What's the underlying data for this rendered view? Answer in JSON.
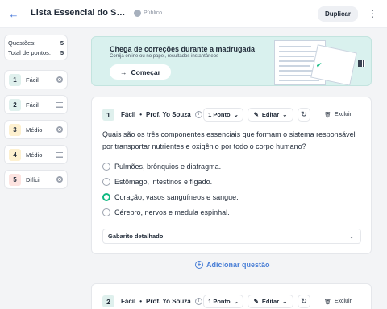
{
  "header": {
    "title": "Lista Essencial do Sistema …",
    "visibility": "Público",
    "duplicate_label": "Duplicar"
  },
  "stats": {
    "questions_label": "Questões:",
    "questions_value": "5",
    "points_label": "Total de pontos:",
    "points_value": "5"
  },
  "sidebar": {
    "items": [
      {
        "number": "1",
        "label": "Fácil",
        "icon": "radio-icon",
        "color": "#dff0ed"
      },
      {
        "number": "2",
        "label": "Fácil",
        "icon": "lines-icon",
        "color": "#dff0ed"
      },
      {
        "number": "3",
        "label": "Médio",
        "icon": "radio-icon",
        "color": "#fdf0cf"
      },
      {
        "number": "4",
        "label": "Médio",
        "icon": "lines-icon",
        "color": "#fdf0cf"
      },
      {
        "number": "5",
        "label": "Difícil",
        "icon": "radio-icon",
        "color": "#fde3e0"
      }
    ]
  },
  "banner": {
    "title": "Chega de correções durante a madrugada",
    "subtitle": "Corrija online ou no papel, resultados instantâneos",
    "button_label": "Começar"
  },
  "question1": {
    "number": "1",
    "difficulty": "Fácil",
    "author": "Prof. Yo Souza",
    "points": "1 Ponto",
    "edit_label": "Editar",
    "delete_label": "Excluir",
    "text": "Quais são os três componentes essenciais que formam o sistema responsável por transportar nutrientes e oxigênio por todo o corpo humano?",
    "options": [
      {
        "text": "Pulmões, brônquios e diafragma.",
        "selected": false
      },
      {
        "text": "Estômago, intestinos e fígado.",
        "selected": false
      },
      {
        "text": "Coração, vasos sanguíneos e sangue.",
        "selected": true
      },
      {
        "text": "Cérebro, nervos e medula espinhal.",
        "selected": false
      }
    ],
    "feedback_label": "Gabarito detalhado"
  },
  "add_question_label": "Adicionar questão",
  "question2": {
    "number": "2",
    "difficulty": "Fácil",
    "author": "Prof. Yo Souza",
    "points": "1 Ponto",
    "edit_label": "Editar",
    "delete_label": "Excluir"
  },
  "colors": {
    "accent": "#4a7fd6",
    "correct": "#10b981",
    "banner_bg": "#d9f1ee"
  }
}
